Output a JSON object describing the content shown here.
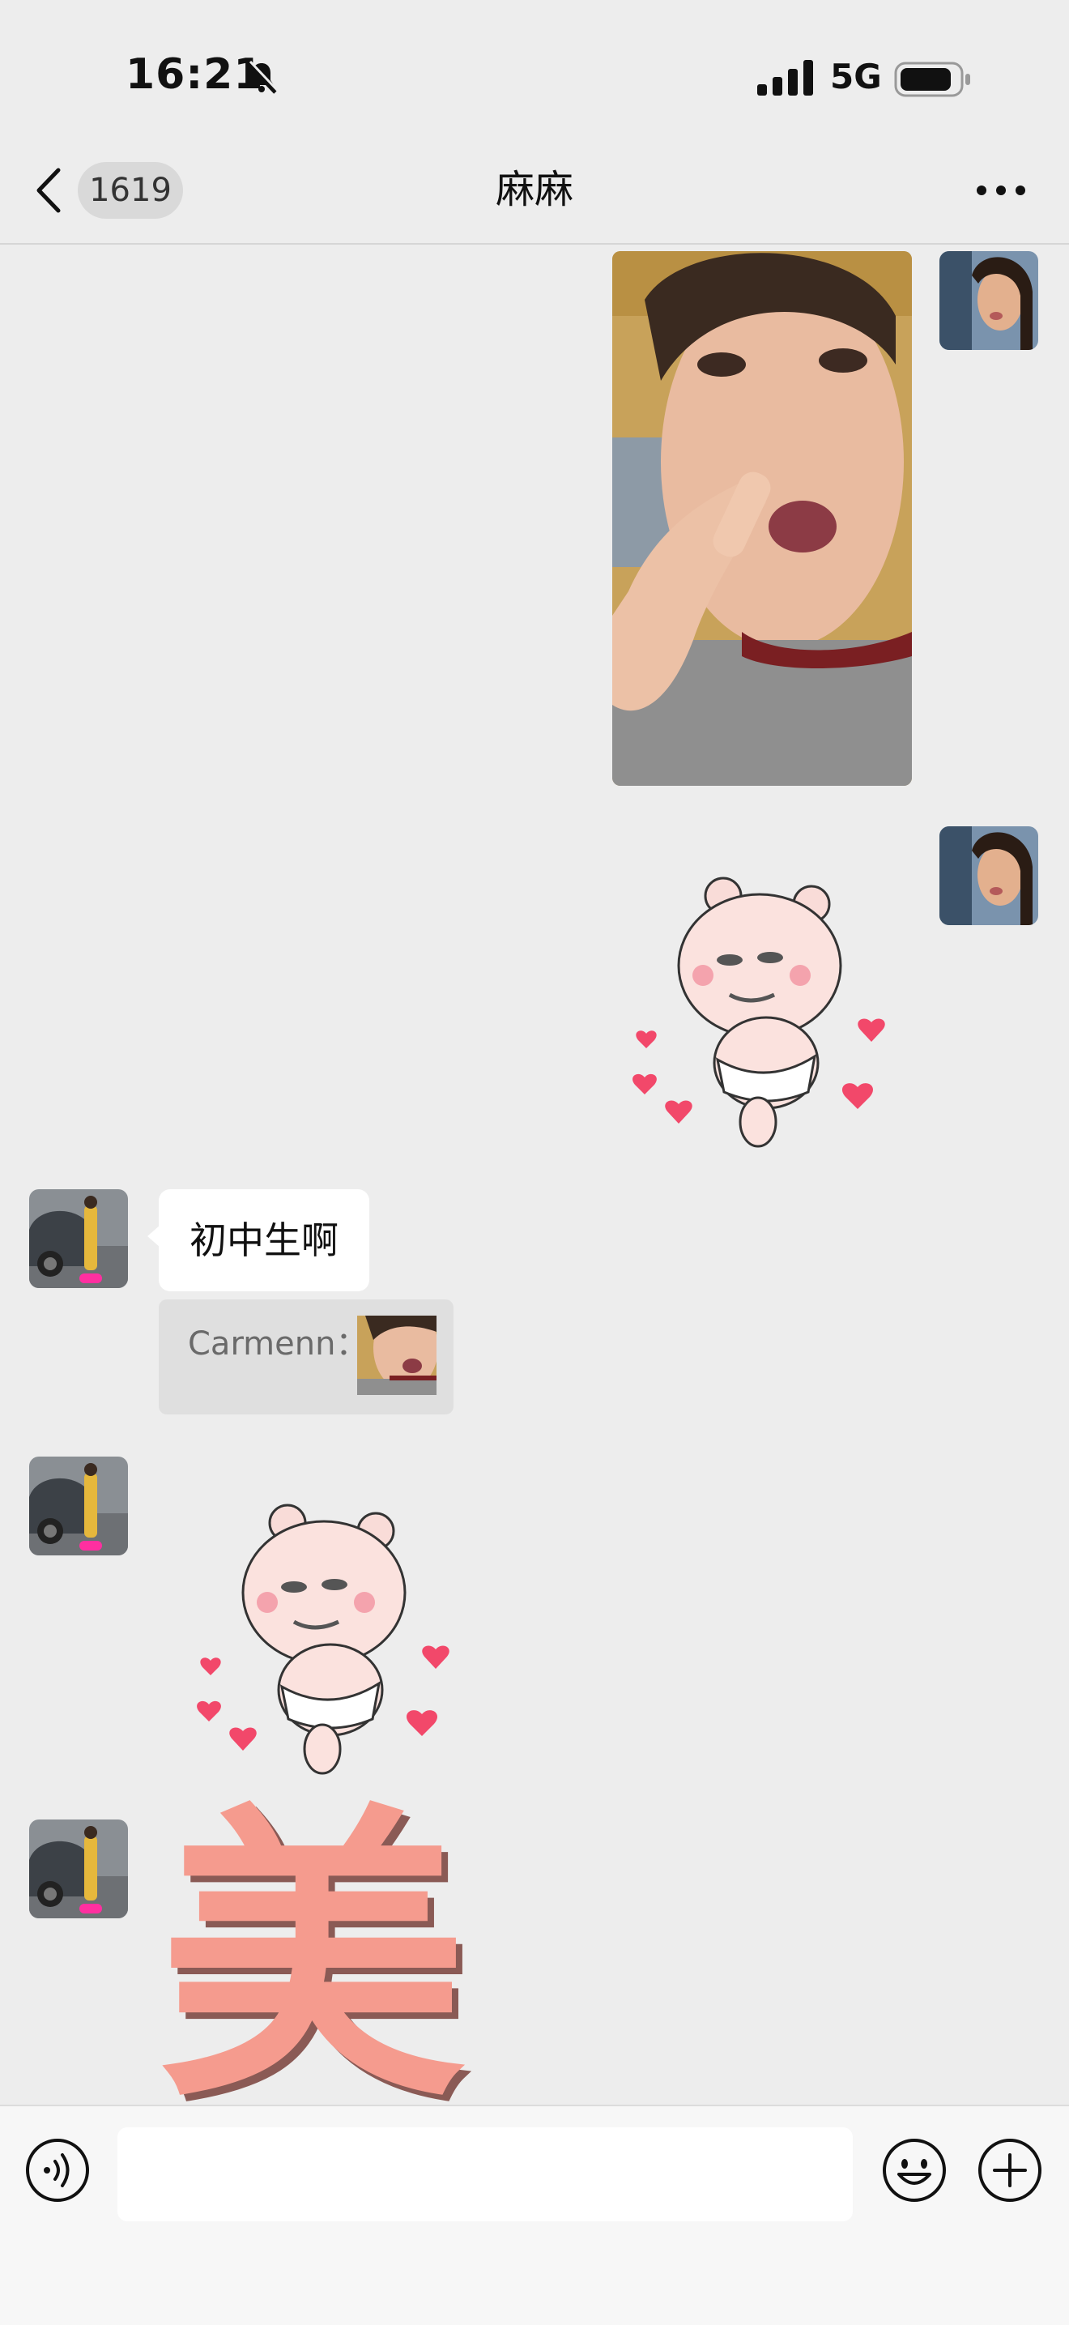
{
  "status_bar": {
    "time": "16:21",
    "network": "5G",
    "icons": [
      "bell-mute-icon",
      "signal-icon",
      "battery-icon"
    ]
  },
  "nav": {
    "unread_count": "1619",
    "title": "麻麻",
    "icons": [
      "back-icon",
      "more-icon"
    ]
  },
  "messages": [
    {
      "side": "right",
      "type": "image",
      "description_icon": "photo-thumbnail"
    },
    {
      "side": "right",
      "type": "sticker",
      "sticker": "bear-hearts-sticker"
    },
    {
      "side": "left",
      "type": "text",
      "text": "初中生啊",
      "quote": {
        "author": "Carmenn："
      }
    },
    {
      "side": "left",
      "type": "sticker",
      "sticker": "bear-hearts-sticker"
    },
    {
      "side": "left",
      "type": "sticker",
      "sticker": "mei-character-sticker",
      "text": "美"
    }
  ],
  "input_bar": {
    "placeholder": "",
    "icons": [
      "voice-icon",
      "emoji-icon",
      "plus-icon"
    ]
  },
  "colors": {
    "background": "#ededed",
    "bubble": "#ffffff",
    "quote": "#dfdfdf",
    "input_bar": "#f7f7f7",
    "mei_sticker": "#f59b8e",
    "heart": "#f2486a"
  }
}
